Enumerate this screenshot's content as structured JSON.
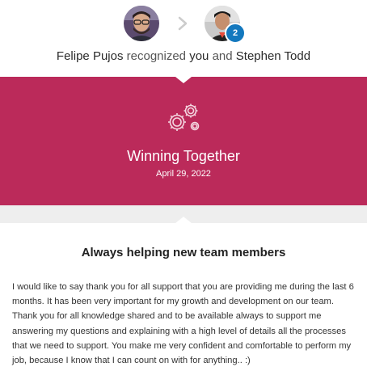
{
  "header": {
    "giver_name": "Felipe Pujos",
    "verb": "recognized",
    "you": "you",
    "conjunction": "and",
    "other_name": "Stephen Todd",
    "recipient_count_badge": "2"
  },
  "badge": {
    "title": "Winning Together",
    "date": "April 29, 2022",
    "icon": "gears-icon"
  },
  "message": {
    "title": "Always helping new team members",
    "body": "I would like to say thank you for all support that you are providing me during the last 6 months. It has been very important for my growth and development on our team. Thank you for all knowledge shared and to be available always to support me answering my questions and explaining with a high level of details all the processes that we need to support. You make me very confident and comfortable to perform my job, because I know that I can count on with for anything.. :)"
  },
  "colors": {
    "banner": "#bb2a5a",
    "count_badge": "#1378be",
    "divider": "#eeeeee"
  }
}
